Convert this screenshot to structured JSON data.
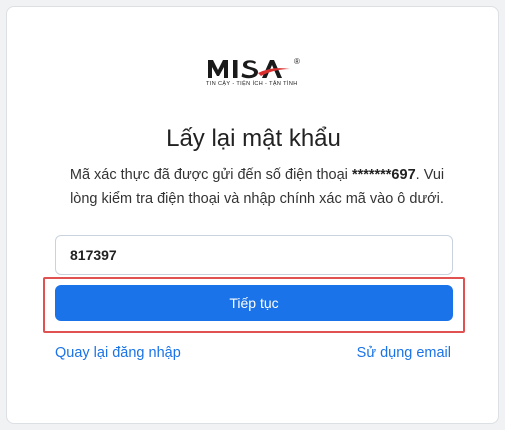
{
  "logo": {
    "brand": "MISA",
    "tagline": "TIN CẬY - TIỆN ÍCH - TẬN TÌNH",
    "registered": "®"
  },
  "title": "Lấy lại mật khẩu",
  "description": {
    "before": "Mã xác thực đã được gửi đến số điện thoại ",
    "phone_masked": "*******697",
    "after": ". Vui lòng kiểm tra điện thoại và nhập chính xác mã vào ô dưới."
  },
  "otp_input": {
    "value": "817397"
  },
  "continue_button": {
    "label": "Tiếp tục"
  },
  "links": {
    "back_to_login": "Quay lại đăng nhập",
    "use_email": "Sử dụng email"
  },
  "colors": {
    "primary": "#1a73e8",
    "highlight_border": "#e05252"
  }
}
